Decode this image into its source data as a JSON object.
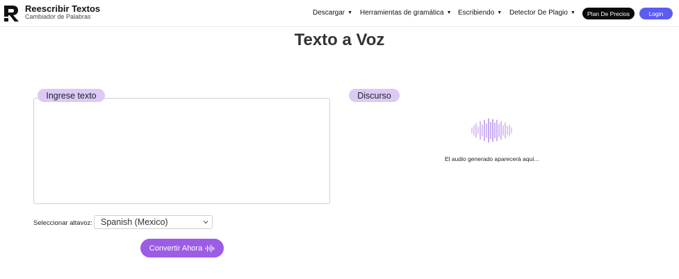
{
  "header": {
    "brand_title": "Reescribir Textos",
    "brand_subtitle": "Cambiador de Palabras",
    "nav": [
      {
        "label": "Descargar"
      },
      {
        "label": "Herramientas de gramática"
      },
      {
        "label": "Escribiendo"
      },
      {
        "label": "Detector De Plagio"
      }
    ],
    "plan_label": "Plan De Precios",
    "login_label": "Login"
  },
  "main": {
    "title": "Texto a Voz",
    "input_label": "Ingrese texto",
    "input_value": "",
    "speaker_label": "Seleccionar altavoz:",
    "speaker_selected": "Spanish (Mexico)",
    "convert_label": "Convertir Ahora",
    "speech_label": "Discurso",
    "audio_placeholder": "El audio generado aparecerá aquí..."
  },
  "colors": {
    "accent_purple": "#9d5ce5",
    "label_pill": "#dcc9f6",
    "login_blue": "#5b5cf0",
    "plan_black": "#0b0b0b"
  }
}
